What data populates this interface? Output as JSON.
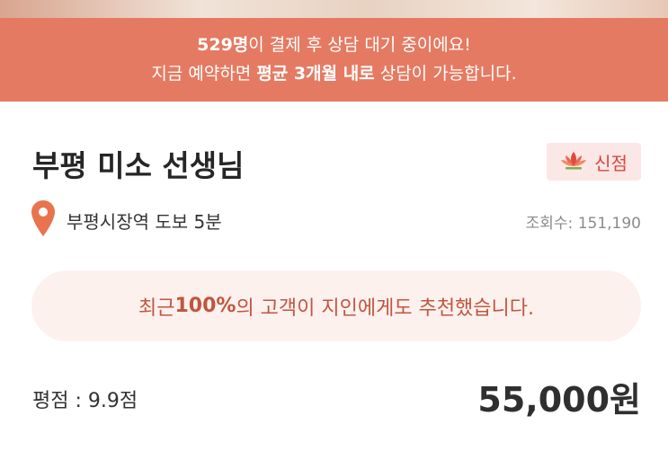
{
  "banner": {
    "line1_bold": "529명",
    "line1_rest": "이 결제 후 상담 대기 중이에요!",
    "line2_pre": "지금 예약하면 ",
    "line2_bold": "평균 3개월 내로",
    "line2_post": " 상담이 가능합니다."
  },
  "profile": {
    "title": "부평 미소 선생님",
    "badge_icon": "lotus-icon",
    "badge_label": "신점",
    "location_icon": "map-pin-icon",
    "location": "부평시장역 도보 5분",
    "views": "조회수: 151,190"
  },
  "recommend": {
    "pre": "최근 ",
    "bold": "100%",
    "post": "의 고객이 지인에게도 추천했습니다."
  },
  "footer": {
    "rating": "평점 : 9.9점",
    "price": "55,000원"
  },
  "colors": {
    "banner_bg": "#e57a62",
    "badge_bg": "#fbe7e5",
    "badge_text": "#d6483c",
    "pin": "#e8744e",
    "recommend_bg": "#fdf1ee",
    "recommend_text": "#c0563f"
  }
}
